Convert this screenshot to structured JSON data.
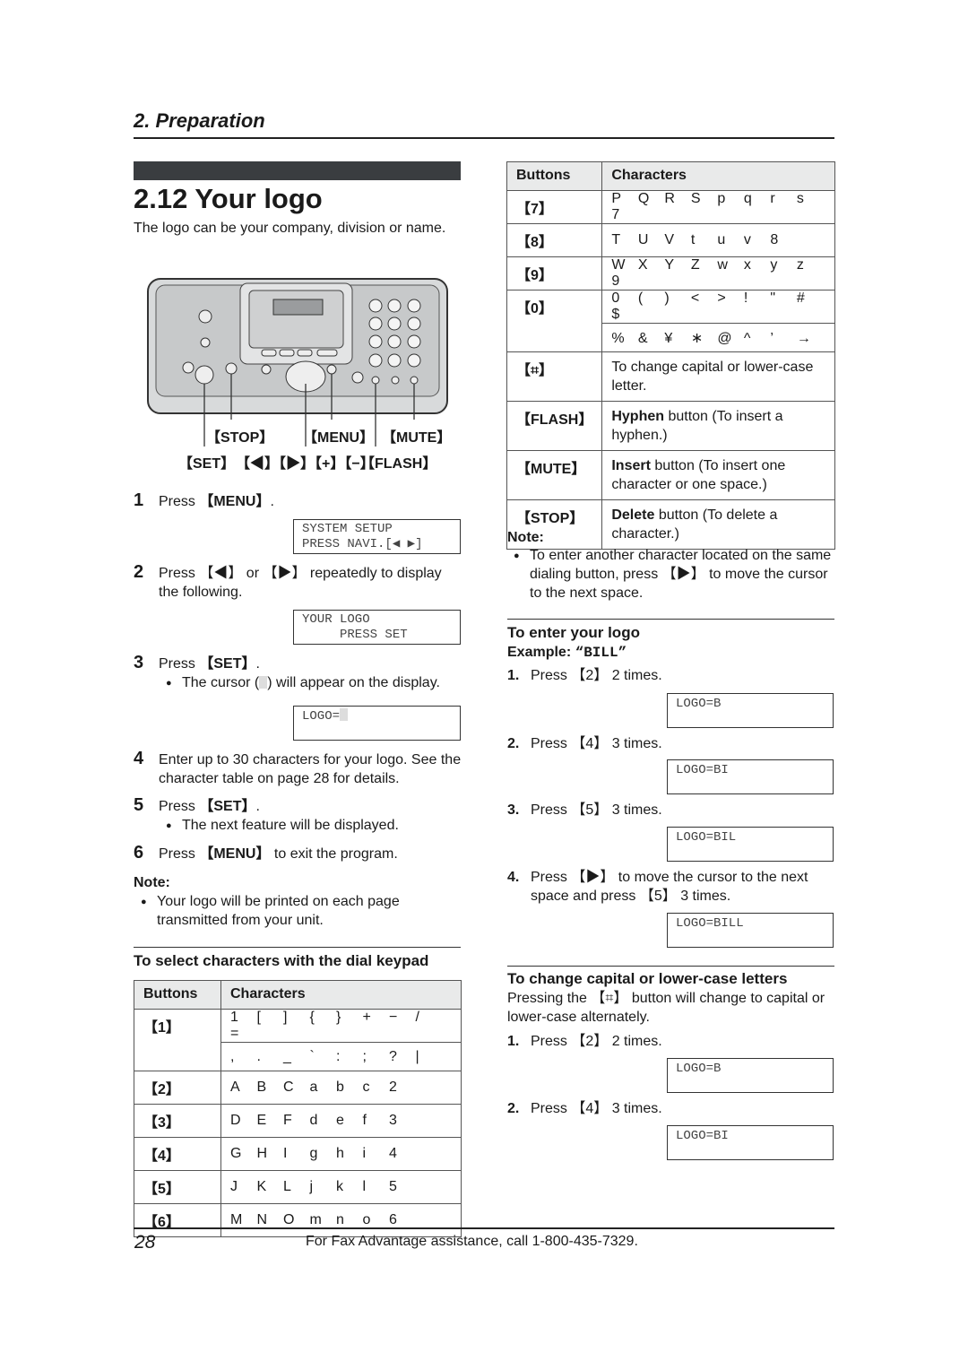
{
  "header": {
    "section": "2. Preparation"
  },
  "title": "2.12 Your logo",
  "intro": "The logo can be your company, division or name.",
  "device_labels": {
    "stop": "【STOP】",
    "menu": "【MENU】",
    "mute": "【MUTE】",
    "set": "【SET】",
    "nav": "【◀】【▶】【+】【−】",
    "flash": "【FLASH】"
  },
  "steps": [
    {
      "n": "1",
      "text": "Press ",
      "key": "【MENU】",
      "tail": ".",
      "lcd": [
        "SYSTEM SETUP",
        "PRESS NAVI.[◀ ▶]"
      ]
    },
    {
      "n": "2",
      "text": "Press 【◀】 or 【▶】 repeatedly to display the following.",
      "lcd": [
        "YOUR LOGO",
        "     PRESS SET"
      ]
    },
    {
      "n": "3",
      "text": "Press ",
      "key": "【SET】",
      "tail": ".",
      "bullet_a": "The cursor (",
      "bullet_b": ") will appear on the display.",
      "lcd": [
        "LOGO="
      ]
    },
    {
      "n": "4",
      "text": "Enter up to 30 characters for your logo. See the character table on page 28 for details."
    },
    {
      "n": "5",
      "text": "Press ",
      "key": "【SET】",
      "tail": ".",
      "bullet": "The next feature will be displayed."
    },
    {
      "n": "6",
      "text": "Press ",
      "key": "【MENU】",
      "tail": " to exit the program."
    }
  ],
  "note_left": {
    "label": "Note:",
    "bullet": "Your logo will be printed on each page transmitted from your unit."
  },
  "dial_section": "To select characters with the dial keypad",
  "table_headers": {
    "buttons": "Buttons",
    "characters": "Characters"
  },
  "table_left": [
    {
      "button": "【1】",
      "chars": [
        [
          "1",
          "[",
          "]",
          "{",
          "}",
          "+",
          "−",
          "/",
          "="
        ],
        [
          ",",
          ".",
          "_",
          "`",
          ":",
          ";",
          "?",
          "|"
        ]
      ]
    },
    {
      "button": "【2】",
      "chars": [
        [
          "A",
          "B",
          "C",
          "a",
          "b",
          "c",
          "2"
        ]
      ]
    },
    {
      "button": "【3】",
      "chars": [
        [
          "D",
          "E",
          "F",
          "d",
          "e",
          "f",
          "3"
        ]
      ]
    },
    {
      "button": "【4】",
      "chars": [
        [
          "G",
          "H",
          "I",
          "g",
          "h",
          "i",
          "4"
        ]
      ]
    },
    {
      "button": "【5】",
      "chars": [
        [
          "J",
          "K",
          "L",
          "j",
          "k",
          "l",
          "5"
        ]
      ]
    },
    {
      "button": "【6】",
      "chars": [
        [
          "M",
          "N",
          "O",
          "m",
          "n",
          "o",
          "6"
        ]
      ]
    }
  ],
  "table_right": [
    {
      "button": "【7】",
      "chars": [
        [
          "P",
          "Q",
          "R",
          "S",
          "p",
          "q",
          "r",
          "s",
          "7"
        ]
      ]
    },
    {
      "button": "【8】",
      "chars": [
        [
          "T",
          "U",
          "V",
          "t",
          "u",
          "v",
          "8"
        ]
      ]
    },
    {
      "button": "【9】",
      "chars": [
        [
          "W",
          "X",
          "Y",
          "Z",
          "w",
          "x",
          "y",
          "z",
          "9"
        ]
      ]
    },
    {
      "button": "【0】",
      "chars": [
        [
          "0",
          "(",
          ")",
          "<",
          ">",
          "!",
          "\"",
          "#",
          "$"
        ],
        [
          "%",
          "&",
          "¥",
          "∗",
          "@",
          "^",
          "’",
          "→"
        ]
      ]
    },
    {
      "button": "【⌗】",
      "desc_bold": "",
      "desc": "To change capital or lower-case letter."
    },
    {
      "button": "【FLASH】",
      "desc_bold": "Hyphen",
      "desc": " button (To insert a hyphen.)"
    },
    {
      "button": "【MUTE】",
      "desc_bold": "Insert",
      "desc": " button (To insert one character or one space.)"
    },
    {
      "button": "【STOP】",
      "desc_bold": "Delete",
      "desc": " button (To delete a character.)"
    }
  ],
  "note_right": {
    "label": "Note:",
    "bullet": "To enter another character located on the same dialing button, press 【▶】 to move the cursor to the next space."
  },
  "enter_logo": {
    "title": "To enter your logo",
    "example_label": "Example: ",
    "example_value": "“BILL”",
    "steps": [
      {
        "n": "1.",
        "text": "Press 【2】 2 times.",
        "lcd": "LOGO=B"
      },
      {
        "n": "2.",
        "text": "Press 【4】 3 times.",
        "lcd": "LOGO=BI"
      },
      {
        "n": "3.",
        "text": "Press 【5】 3 times.",
        "lcd": "LOGO=BIL"
      },
      {
        "n": "4.",
        "text": "Press 【▶】 to move the cursor to the next space and press 【5】 3 times.",
        "lcd": "LOGO=BILL"
      }
    ]
  },
  "change_case": {
    "title": "To change capital or lower-case letters",
    "text": "Pressing the 【⌗】 button will change to capital or lower-case alternately.",
    "steps": [
      {
        "n": "1.",
        "text": "Press 【2】 2 times.",
        "lcd": "LOGO=B"
      },
      {
        "n": "2.",
        "text": "Press 【4】 3 times.",
        "lcd": "LOGO=BI"
      }
    ]
  },
  "footer": {
    "page": "28",
    "text": "For Fax Advantage assistance, call 1-800-435-7329."
  }
}
